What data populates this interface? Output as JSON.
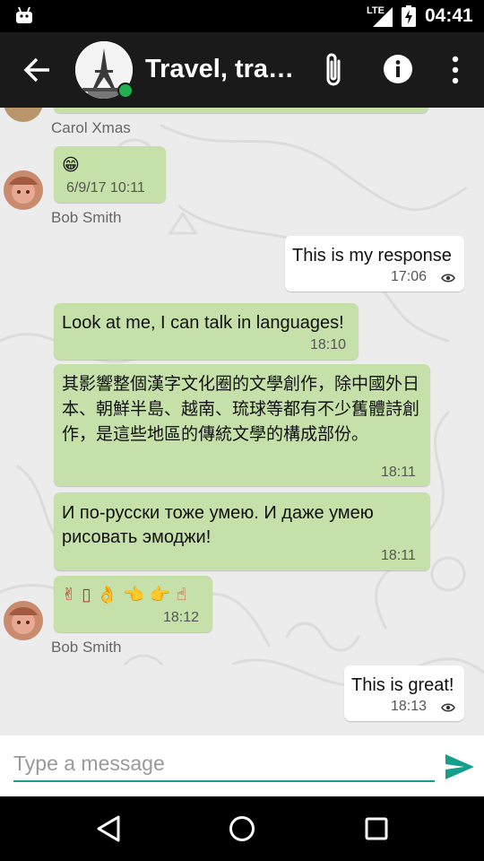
{
  "status_bar": {
    "network": "LTE",
    "time": "04:41"
  },
  "header": {
    "title": "Travel, trav…"
  },
  "messages": [
    {
      "sender": "Carol Xmas"
    },
    {
      "text": "😁",
      "time": "6/9/17 10:11",
      "sender": "Bob Smith"
    },
    {
      "text": "This is my response",
      "time": "17:06"
    },
    {
      "text": "Look at me, I can talk in languages!",
      "time": "18:10"
    },
    {
      "text": "其影響整個漢字文化圈的文學創作，除中國外日本、朝鮮半島、越南、琉球等都有不少舊體詩創作，是這些地區的傳統文學的構成部份。",
      "time": "18:11"
    },
    {
      "text": "И по-русски тоже умею. И даже умею рисовать эмоджи!",
      "time": "18:11"
    },
    {
      "text": "✌ ▯ 👌 👈 👉 ☝",
      "time": "18:12",
      "sender": "Bob Smith"
    },
    {
      "text": "This is great!",
      "time": "18:13"
    }
  ],
  "composer": {
    "placeholder": "Type a message"
  },
  "colors": {
    "incoming_bubble": "#c5e0a8",
    "outgoing_bubble": "#ffffff",
    "accent": "#169e8c",
    "online": "#23b14d"
  }
}
